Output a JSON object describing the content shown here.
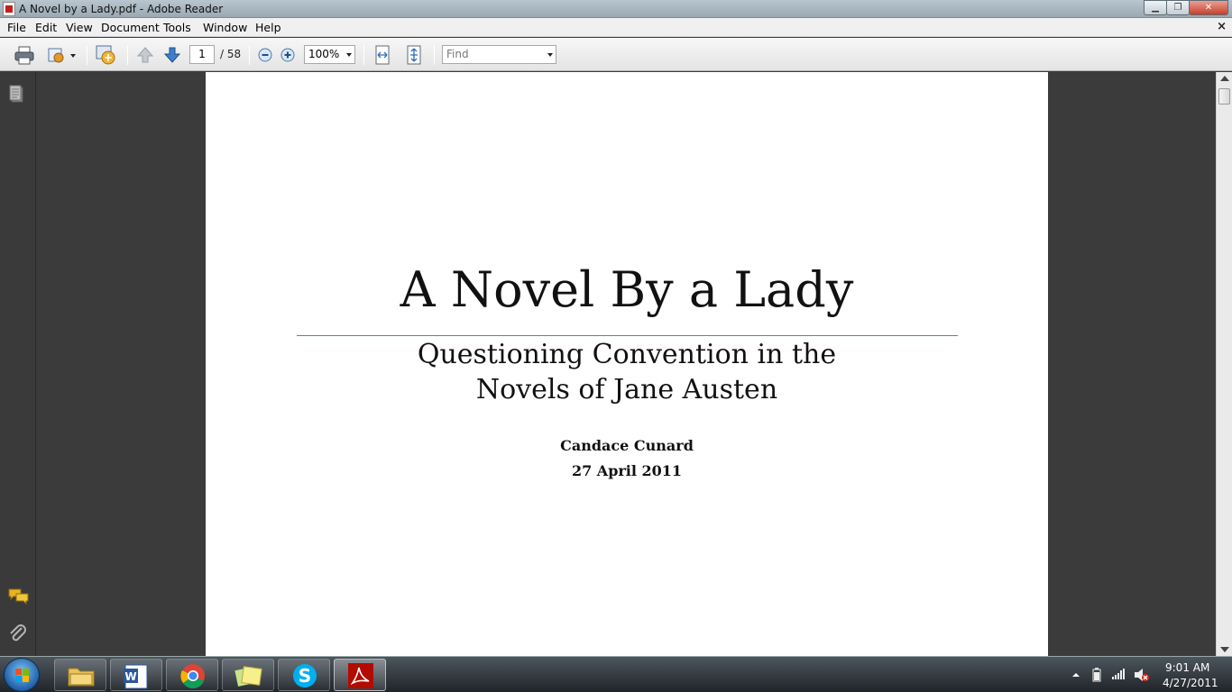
{
  "window": {
    "title": "A Novel by a Lady.pdf - Adobe Reader",
    "minimize_glyph": "▁",
    "restore_glyph": "❐",
    "close_glyph": "✕"
  },
  "menu": {
    "items": [
      "File",
      "Edit",
      "View",
      "Document",
      "Tools",
      "Window",
      "Help"
    ],
    "close_glyph": "×"
  },
  "toolbar": {
    "page_current": "1",
    "page_total": "/ 58",
    "zoom": "100%",
    "find_placeholder": "Find"
  },
  "document": {
    "title": "A Novel By a Lady",
    "subtitle_line1": "Questioning Convention in the",
    "subtitle_line2": "Novels of Jane Austen",
    "author": "Candace Cunard",
    "date": "27 April 2011"
  },
  "taskbar": {
    "time": "9:01 AM",
    "date": "4/27/2011",
    "apps": [
      "windows-explorer",
      "microsoft-word",
      "google-chrome",
      "sticky-notes",
      "skype",
      "adobe-reader"
    ]
  },
  "colors": {
    "rule": "#4f8a99",
    "pdf_red": "#c0201e"
  }
}
